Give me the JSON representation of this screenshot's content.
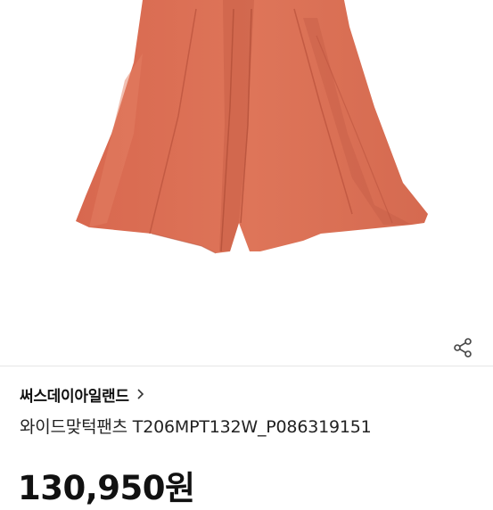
{
  "brand": {
    "name": "써스데이아일랜드"
  },
  "product": {
    "title": "와이드맞턱팬츠 T206MPT132W_P086319151",
    "price": "130,950원"
  },
  "icons": {
    "share": "share-icon",
    "brand_chevron": "chevron-right-icon"
  },
  "colors": {
    "product_fabric": "#d86e55",
    "text_primary": "#111111",
    "divider": "#e6e6e6"
  }
}
